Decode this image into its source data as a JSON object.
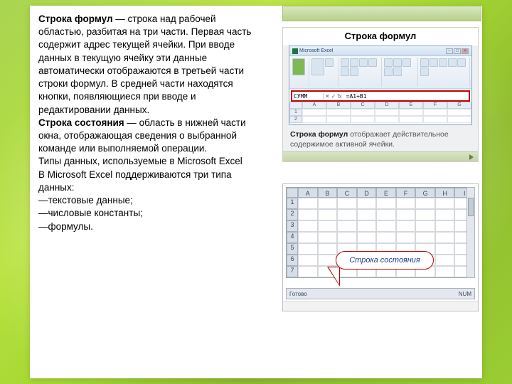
{
  "text": {
    "p1_bold": "Строка формул",
    "p1_rest": " — строка над рабочей областью, разбитая на три части. Первая часть содержит адрес текущей ячейки. При вводе данных в текущую ячейку эти данные автоматически отображаются в третьей части строки формул. В средней части находятся кнопки, появляющиеся при вводе и редактировании данных.",
    "p2_bold": "Строка состояния",
    "p2_rest": " — область в нижней части окна, отображающая сведения о выбранной команде или выполняемой операции.",
    "p3": "Типы данных, используемые в Microsoft Excel",
    "p4": "В Microsoft Excel поддерживаются три типа данных:",
    "li1": "—текстовые данные;",
    "li2": "—числовые константы;",
    "li3": "—формулы."
  },
  "fig1": {
    "title": "Строка формул",
    "app_title": "Microsoft Excel",
    "formula_name": "СУММ",
    "formula_content": "=A1+B1",
    "caption_bold": "Строка формул",
    "caption_rest": " отображает действительное содержимое активной ячейки.",
    "cols": [
      "A",
      "B",
      "C",
      "D",
      "E",
      "F",
      "G"
    ]
  },
  "fig2": {
    "cols": [
      "A",
      "B",
      "C",
      "D",
      "E",
      "F",
      "G",
      "H",
      "I"
    ],
    "rows": [
      "1",
      "2",
      "3",
      "4",
      "5",
      "6",
      "7"
    ],
    "callout": "Строка состояния",
    "status_left": "Готово",
    "status_right": "NUM"
  }
}
